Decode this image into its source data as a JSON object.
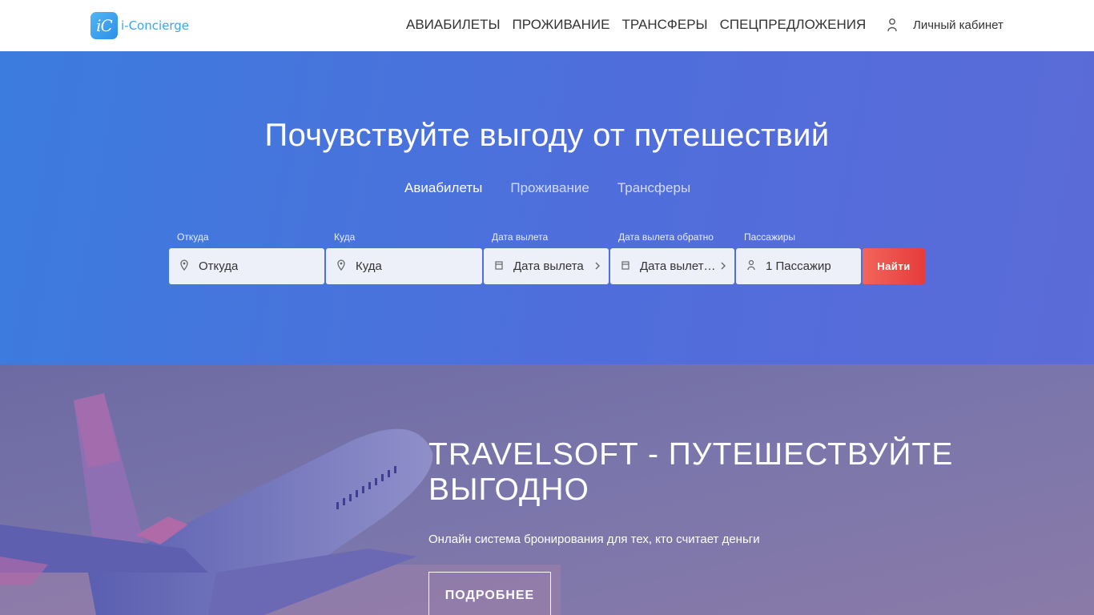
{
  "header": {
    "logo_text": "i-Concierge",
    "logo_mark": "iC",
    "nav": [
      "АВИАБИЛЕТЫ",
      "ПРОЖИВАНИЕ",
      "ТРАНСФЕРЫ",
      "СПЕЦПРЕДЛОЖЕНИЯ"
    ],
    "user_icon": "user-icon",
    "cabinet_label": "Личный кабинет"
  },
  "hero": {
    "title": "Почувствуйте выгоду от путешествий",
    "tabs": [
      "Авиабилеты",
      "Проживание",
      "Трансферы"
    ],
    "active_tab": "Авиабилеты",
    "form": {
      "from": {
        "label": "Откуда",
        "value": "Откуда",
        "icon": "location-pin-icon"
      },
      "to": {
        "label": "Куда",
        "value": "Куда",
        "icon": "location-pin-icon"
      },
      "depart": {
        "label": "Дата вылета",
        "value": "Дата вылета",
        "icon": "calendar-icon"
      },
      "return": {
        "label": "Дата вылета обратно",
        "value": "Дата вылета обратно",
        "icon": "calendar-icon"
      },
      "passengers": {
        "label": "Пассажиры",
        "value": "1 Пассажир",
        "icon": "user-icon"
      },
      "submit": "Найти"
    }
  },
  "promo": {
    "title": "TRAVELSOFT - ПУТЕШЕСТВУЙТЕ ВЫГОДНО",
    "subtitle": "Онлайн система бронирования для тех, кто считает деньги",
    "button": "ПОДРОБНЕЕ"
  },
  "colors": {
    "hero_gradient_start": "#3c7cde",
    "hero_gradient_end": "#5b6bd8",
    "promo_bg": "#7474a6",
    "find_button": "#e63b3b",
    "logo_accent": "#3aa6ea"
  }
}
